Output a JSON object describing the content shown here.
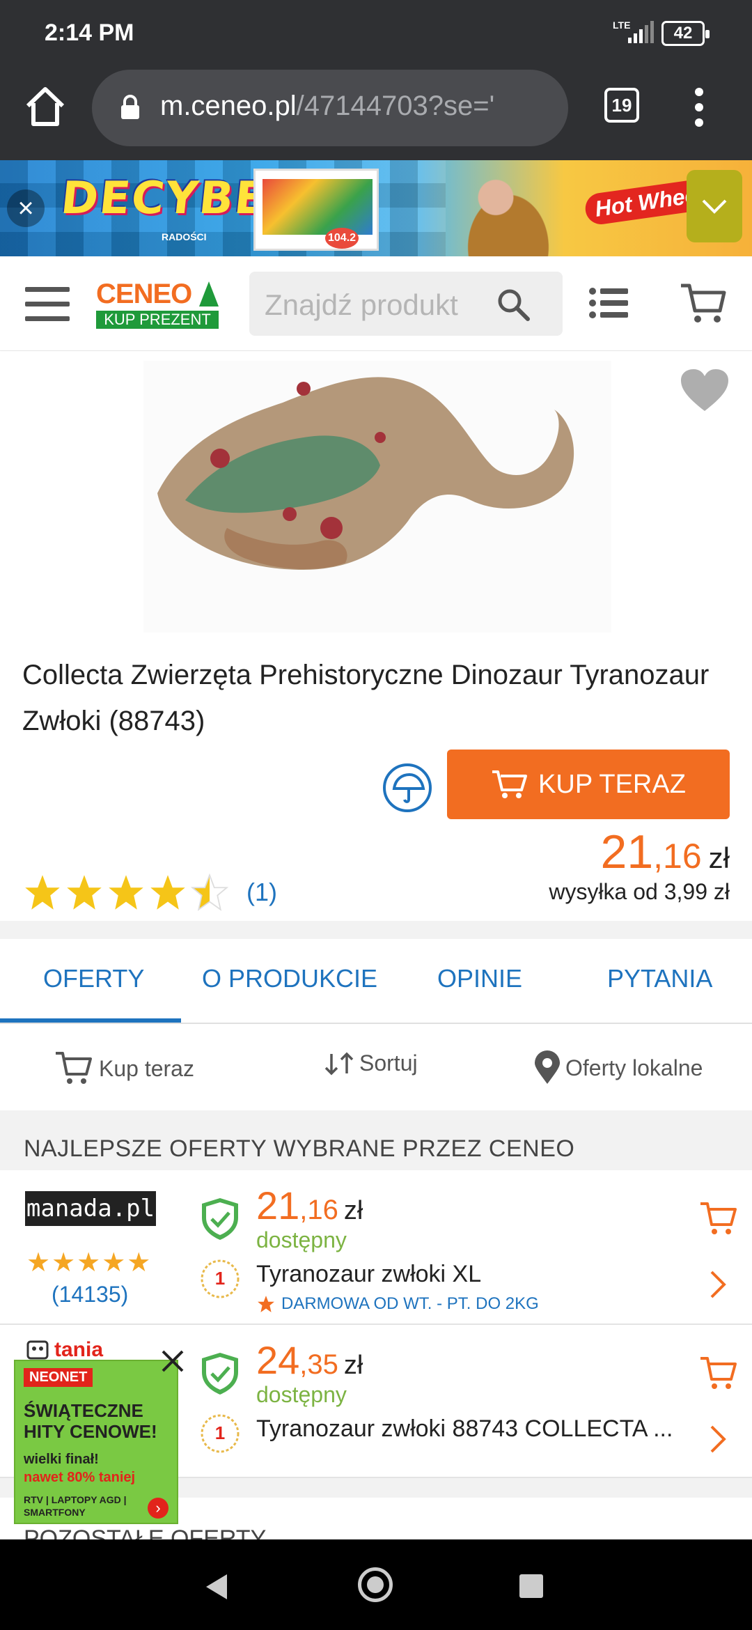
{
  "status": {
    "time": "2:14 PM",
    "network": "LTE",
    "battery": "42"
  },
  "browser": {
    "url_host": "m.ceneo.pl",
    "url_path": "/47144703?se='",
    "tab_count": "19"
  },
  "banner": {
    "brand": "DECYBELE",
    "brand_sub": "RADOŚCI",
    "box_badge": "104.2",
    "hw": "Hot Wheels"
  },
  "header": {
    "logo_word": "CENEO",
    "logo_sub": "KUP PREZENT",
    "search_placeholder": "Znajdź produkt"
  },
  "product": {
    "title": "Collecta Zwierzęta Prehistoryczne Dinozaur Tyranozaur Zwłoki (88743)",
    "buy_label": "KUP TERAZ",
    "price_int": "21",
    "price_cents": ",16",
    "currency": "zł",
    "shipping": "wysyłka od 3,99 zł",
    "rating": 4.5,
    "reviews": "(1)"
  },
  "tabs": [
    "OFERTY",
    "O PRODUKCIE",
    "OPINIE",
    "PYTANIA"
  ],
  "tools": {
    "buy_now": "Kup teraz",
    "sort": "Sortuj",
    "local": "Oferty lokalne"
  },
  "best_offers_title": "NAJLEPSZE OFERTY WYBRANE PRZEZ CENEO",
  "offers": [
    {
      "shop": "manada.pl",
      "stars": "★★★★★",
      "shop_count": "(14135)",
      "price_int": "21",
      "price_cents": ",16",
      "currency": "zł",
      "availability": "dostępny",
      "name": "Tyranozaur zwłoki XL",
      "delivery": "DARMOWA OD WT. - PT. DO 2KG"
    },
    {
      "shop": "tania",
      "price_int": "24",
      "price_cents": ",35",
      "currency": "zł",
      "availability": "dostępny",
      "name": "Tyranozaur zwłoki 88743 COLLECTA ..."
    }
  ],
  "ad": {
    "badge": "NEONET",
    "headline": "ŚWIĄTECZNE HITY CENOWE!",
    "line1": "wielki finał!",
    "line2": "nawet 80% taniej",
    "line3": "RTV | LAPTOPY AGD | SMARTFONY"
  },
  "other_offers_title": "POZOSTAŁE OFERTY",
  "colors": {
    "accent": "#f26d21",
    "link": "#1e73be",
    "available": "#7cb342",
    "chrome": "#2f3033"
  }
}
